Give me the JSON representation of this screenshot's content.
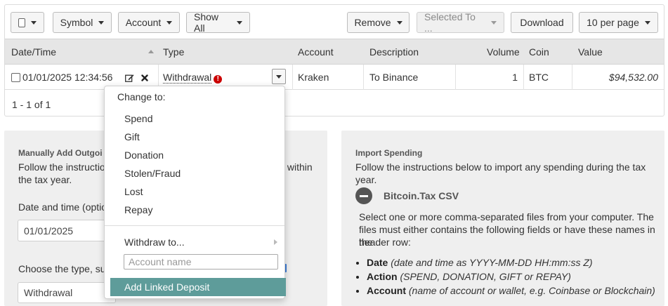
{
  "toolbar": {
    "symbol": "Symbol",
    "account": "Account",
    "show_all": "Show All",
    "remove": "Remove",
    "selected_to": "Selected To ...",
    "download": "Download",
    "per_page": "10 per page"
  },
  "table": {
    "headers": [
      "Date/Time",
      "Type",
      "Account",
      "Description",
      "Volume",
      "Coin",
      "Value"
    ],
    "row": {
      "datetime": "01/01/2025 12:34:56",
      "type": "Withdrawal",
      "account": "Kraken",
      "description": "To Binance",
      "volume": "1",
      "coin": "BTC",
      "value": "$94,532.00"
    },
    "count": "1 - 1 of 1"
  },
  "left_panel": {
    "title": "Manually Add Outgoi",
    "line1_start": "Follow the instruction",
    "line1_end": "s within",
    "line2": "the tax year.",
    "date_label": "Date and time (optior",
    "date_value": "01/01/2025",
    "type_label": "Choose the type, suc",
    "type_value": "Withdrawal"
  },
  "right_panel": {
    "title": "Import Spending",
    "intro": "Follow the instructions below to import any spending during the tax year.",
    "section_title": "Bitcoin.Tax CSV",
    "para_1": "Select one or more comma-separated files from your computer. The",
    "para_2": "files must either contains the following fields or have these names in the",
    "para_3": "header row:",
    "fields": [
      {
        "name": "Date",
        "desc": "(date and time as YYYY-MM-DD HH:mm:ss Z)"
      },
      {
        "name": "Action",
        "desc": "(SPEND, DONATION, GIFT or REPAY)"
      },
      {
        "name": "Account",
        "desc": "(name of account or wallet, e.g. Coinbase or Blockchain)"
      }
    ]
  },
  "menu": {
    "header": "Change to:",
    "items": [
      "Spend",
      "Gift",
      "Donation",
      "Stolen/Fraud",
      "Lost",
      "Repay"
    ],
    "withdraw_to": "Withdraw to...",
    "account_placeholder": "Account name",
    "add_linked_deposit": "Add Linked Deposit"
  },
  "colors": {
    "highlight": "#5e9c9a",
    "warning": "#cc0000",
    "header_bg": "#e6e6e6"
  }
}
